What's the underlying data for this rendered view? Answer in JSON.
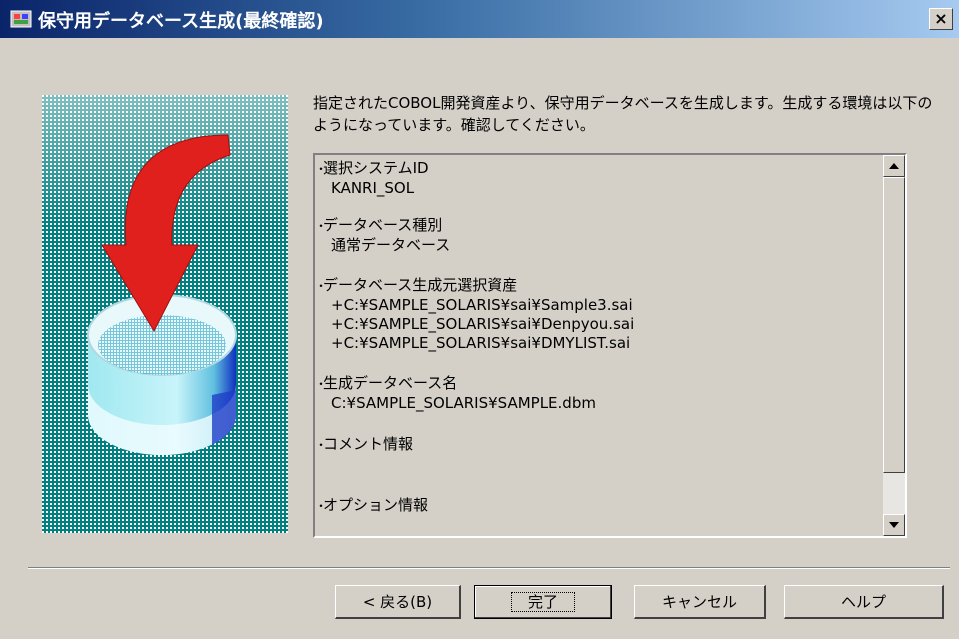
{
  "window": {
    "title": "保守用データベース生成(最終確認)",
    "close_label": "×"
  },
  "intro_text": "指定されたCOBOL開発資産より、保守用データベースを生成します。生成する環境は以下のようになっています。確認してください。",
  "summary": {
    "sections": [
      {
        "heading": "選択システムID",
        "values": [
          "KANRI_SOL"
        ]
      },
      {
        "heading": "データベース種別",
        "values": [
          "通常データベース"
        ]
      },
      {
        "heading": "データベース生成元選択資産",
        "values": [
          "+C:¥SAMPLE_SOLARIS¥sai¥Sample3.sai",
          "+C:¥SAMPLE_SOLARIS¥sai¥Denpyou.sai",
          "+C:¥SAMPLE_SOLARIS¥sai¥DMYLIST.sai"
        ]
      },
      {
        "heading": "生成データベース名",
        "values": [
          "C:¥SAMPLE_SOLARIS¥SAMPLE.dbm"
        ]
      },
      {
        "heading": "コメント情報",
        "values": []
      },
      {
        "heading": "オプション情報",
        "values": []
      }
    ]
  },
  "buttons": {
    "back": "< 戻る(B)",
    "finish": "完了",
    "cancel": "キャンセル",
    "help": "ヘルプ"
  },
  "icons": {
    "app": "database-wizard-icon",
    "illustration": "database-arrow-illustration"
  },
  "colors": {
    "titlebar_start": "#0a246a",
    "titlebar_end": "#a6caf0",
    "image_bg": "#008080",
    "arrow": "#e0201c",
    "dialog_bg": "#d4d0c8"
  }
}
